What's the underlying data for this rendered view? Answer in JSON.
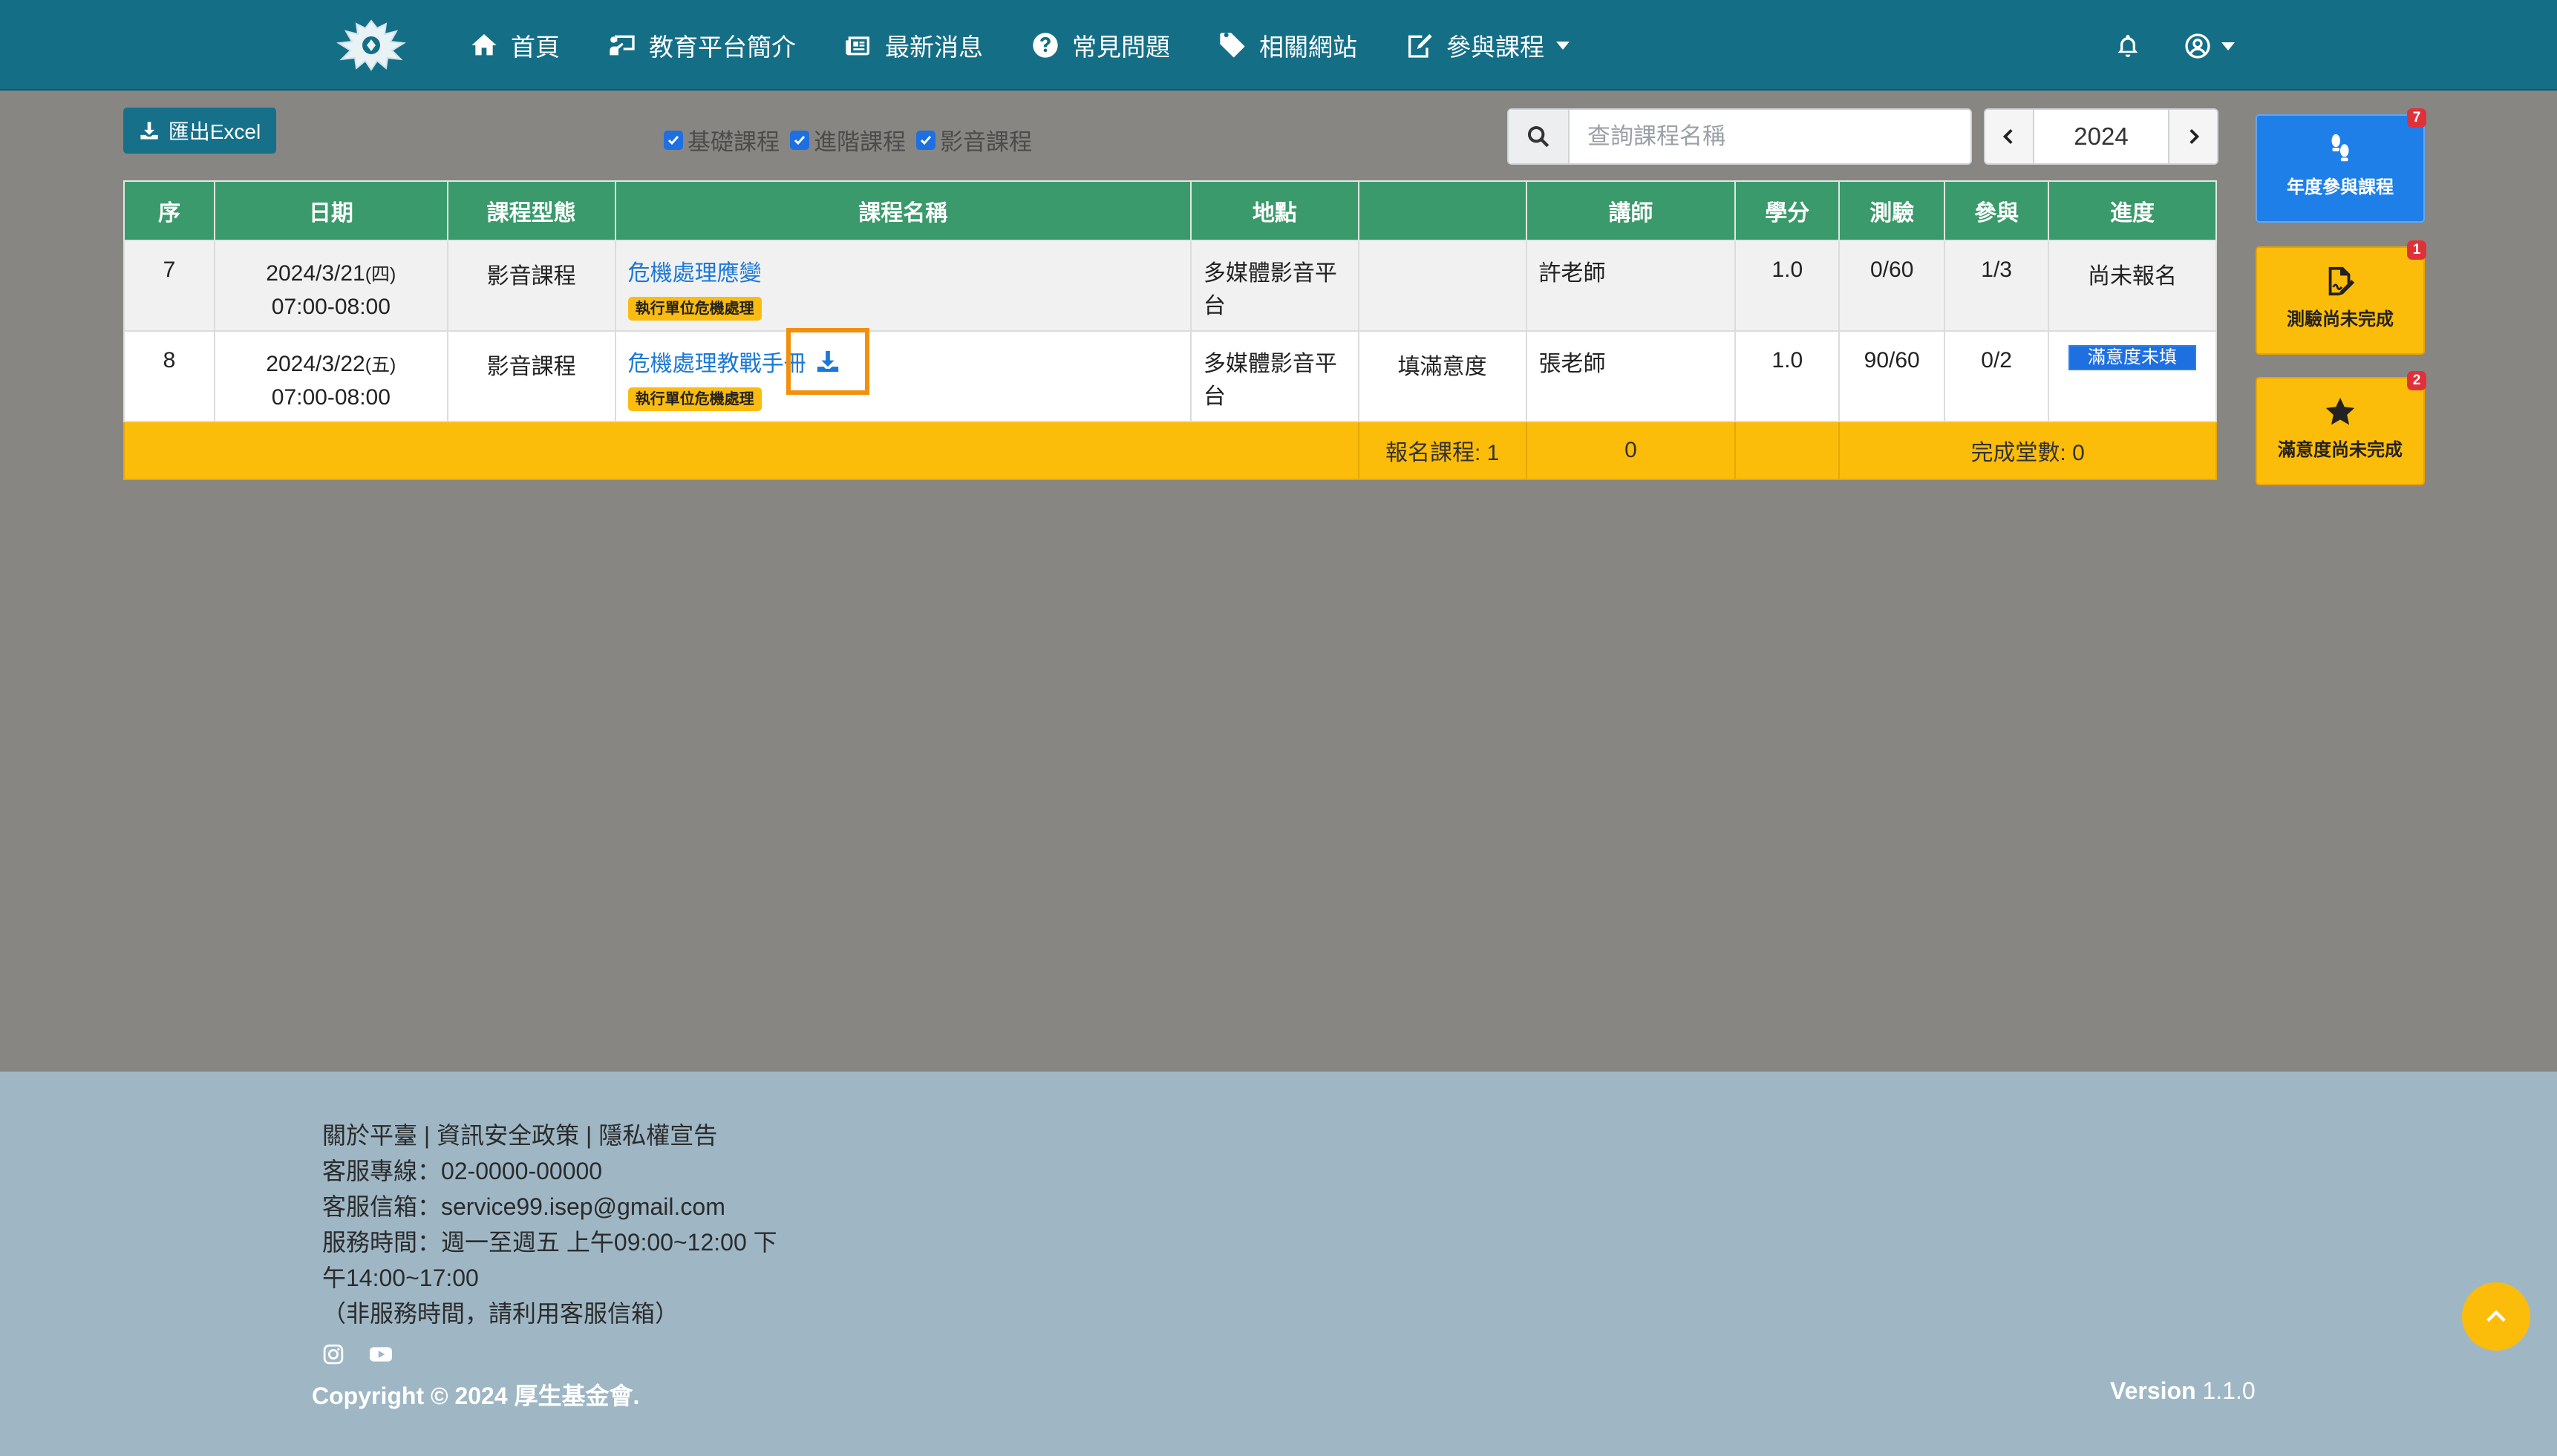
{
  "nav": {
    "items": [
      {
        "label": "首頁",
        "icon": "home-icon"
      },
      {
        "label": "教育平台簡介",
        "icon": "presentation-icon"
      },
      {
        "label": "最新消息",
        "icon": "newspaper-icon"
      },
      {
        "label": "常見問題",
        "icon": "question-circle-icon"
      },
      {
        "label": "相關網站",
        "icon": "tag-icon"
      },
      {
        "label": "參與課程",
        "icon": "edit-icon"
      }
    ]
  },
  "toolbar": {
    "excel_label": "匯出Excel",
    "filters": [
      "基礎課程",
      "進階課程",
      "影音課程"
    ],
    "search_placeholder": "查詢課程名稱",
    "year": "2024"
  },
  "table": {
    "headers": [
      "序",
      "日期",
      "課程型態",
      "課程名稱",
      "地點",
      "",
      "講師",
      "學分",
      "測驗",
      "參與",
      "進度"
    ],
    "rows": [
      {
        "seq": "7",
        "date": "2024/3/21",
        "weekday": "(四)",
        "time": "07:00-08:00",
        "type": "影音課程",
        "name": "危機處理應變",
        "tag": "執行單位危機處理",
        "location": "多媒體影音平台",
        "action": "",
        "teacher": "許老師",
        "credit": "1.0",
        "quiz": "0/60",
        "attend": "1/3",
        "progress": "尚未報名"
      },
      {
        "seq": "8",
        "date": "2024/3/22",
        "weekday": "(五)",
        "time": "07:00-08:00",
        "type": "影音課程",
        "name": "危機處理教戰手冊",
        "tag": "執行單位危機處理",
        "location": "多媒體影音平台",
        "action": "填滿意度",
        "teacher": "張老師",
        "credit": "1.0",
        "quiz": "90/60",
        "attend": "0/2",
        "progress": "滿意度未填"
      }
    ],
    "totals": {
      "registered": "報名課程: 1",
      "count": "0",
      "completed": "完成堂數: 0"
    }
  },
  "widgets": [
    {
      "label": "年度參與課程",
      "badge": "7",
      "icon": "footprints-icon"
    },
    {
      "label": "測驗尚未完成",
      "badge": "1",
      "icon": "signature-icon"
    },
    {
      "label": "滿意度尚未完成",
      "badge": "2",
      "icon": "star-icon"
    }
  ],
  "footer": {
    "links": "關於平臺 | 資訊安全政策 | 隱私權宣告",
    "phone": "客服專線：02-0000-00000",
    "email": "客服信箱：service99.isep@gmail.com",
    "hours_1": "服務時間：週一至週五 上午09:00~12:00 下",
    "hours_2": "午14:00~17:00",
    "hours_note": "（非服務時間，請利用客服信箱）",
    "copyright": "Copyright © 2024 厚生基金會.",
    "version_label": "Version",
    "version_num": "1.1.0"
  },
  "colors": {
    "navbar": "#146e86",
    "table_header": "#3a9a6c",
    "accent_yellow": "#fcbc0a",
    "link_blue": "#1b78d6",
    "type_red": "#e0313a",
    "footer": "#9fb7c5"
  }
}
